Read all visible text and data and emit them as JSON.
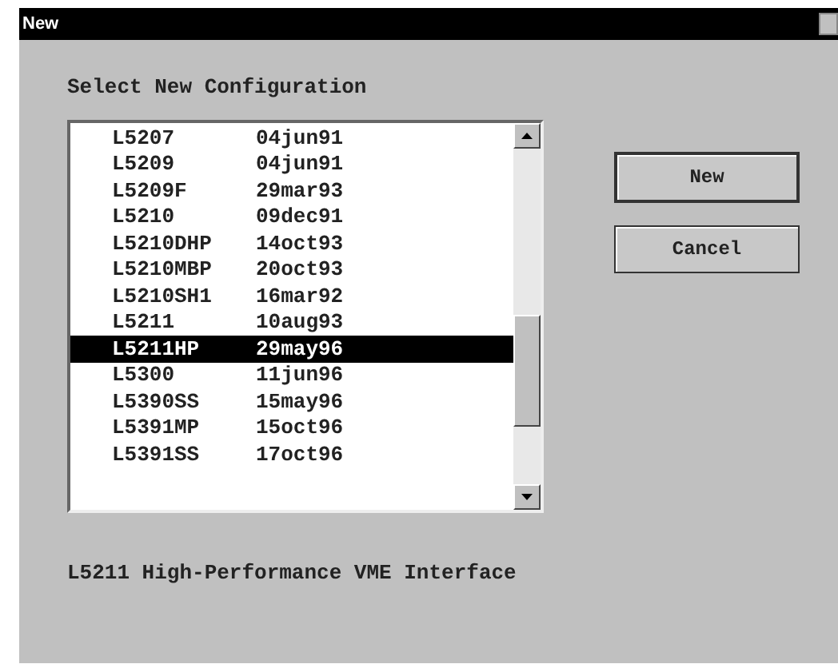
{
  "window": {
    "title": "New"
  },
  "prompt": "Select New Configuration",
  "list": [
    {
      "name": "L5207",
      "date": "04jun91",
      "selected": false
    },
    {
      "name": "L5209",
      "date": "04jun91",
      "selected": false
    },
    {
      "name": "L5209F",
      "date": "29mar93",
      "selected": false
    },
    {
      "name": "L5210",
      "date": "09dec91",
      "selected": false
    },
    {
      "name": "L5210DHP",
      "date": "14oct93",
      "selected": false
    },
    {
      "name": "L5210MBP",
      "date": "20oct93",
      "selected": false
    },
    {
      "name": "L5210SH1",
      "date": "16mar92",
      "selected": false
    },
    {
      "name": "L5211",
      "date": "10aug93",
      "selected": false
    },
    {
      "name": "L5211HP",
      "date": "29may96",
      "selected": true
    },
    {
      "name": "L5300",
      "date": "11jun96",
      "selected": false
    },
    {
      "name": "L5390SS",
      "date": "15may96",
      "selected": false
    },
    {
      "name": "L5391MP",
      "date": "15oct96",
      "selected": false
    },
    {
      "name": "L5391SS",
      "date": "17oct96",
      "selected": false
    }
  ],
  "buttons": [
    {
      "label": "New",
      "kind": "default"
    },
    {
      "label": "Cancel",
      "kind": "normal"
    }
  ],
  "description": "L5211 High-Performance VME Interface"
}
